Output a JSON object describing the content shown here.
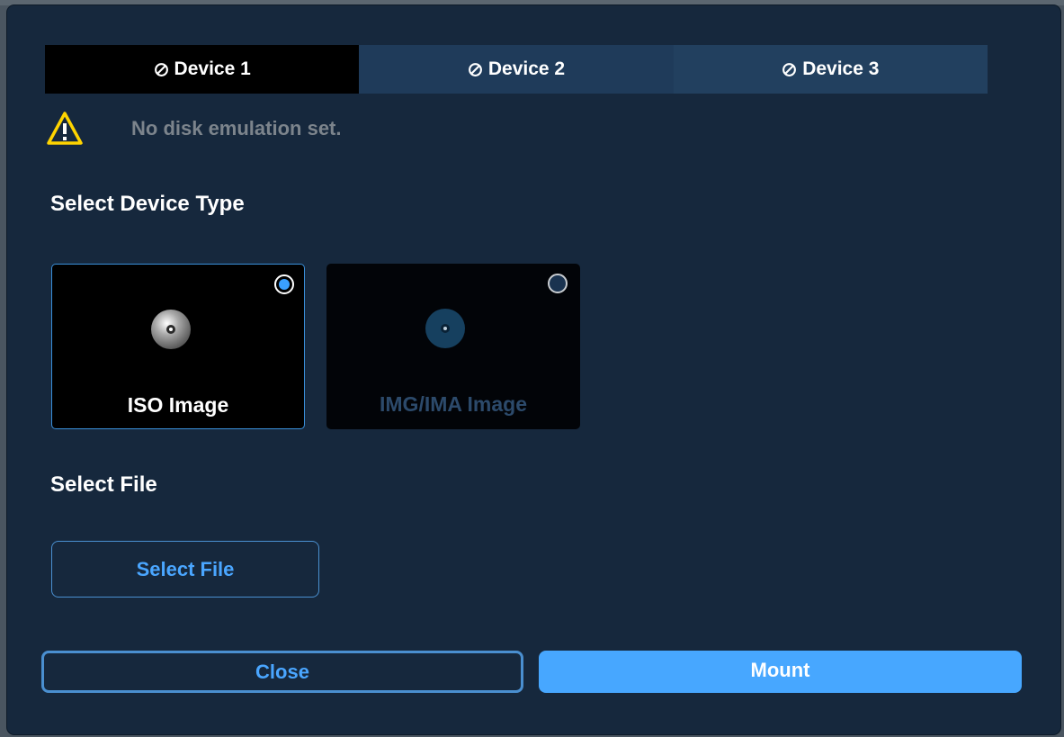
{
  "tabs": [
    {
      "label": "Device 1",
      "icon": "ban-icon",
      "active": true
    },
    {
      "label": "Device 2",
      "icon": "ban-icon",
      "active": false
    },
    {
      "label": "Device 3",
      "icon": "ban-icon",
      "active": false
    }
  ],
  "warning": {
    "icon": "warning-icon",
    "text": "No disk emulation set."
  },
  "device_type": {
    "title": "Select Device Type",
    "options": [
      {
        "label": "ISO Image",
        "icon": "disc-icon",
        "selected": true
      },
      {
        "label": "IMG/IMA Image",
        "icon": "disc-icon",
        "selected": false
      }
    ]
  },
  "file": {
    "title": "Select File",
    "button_label": "Select File"
  },
  "footer": {
    "close_label": "Close",
    "mount_label": "Mount"
  },
  "colors": {
    "accent": "#47a7ff",
    "dialog_bg": "#16283d",
    "warning": "#ffd400"
  }
}
